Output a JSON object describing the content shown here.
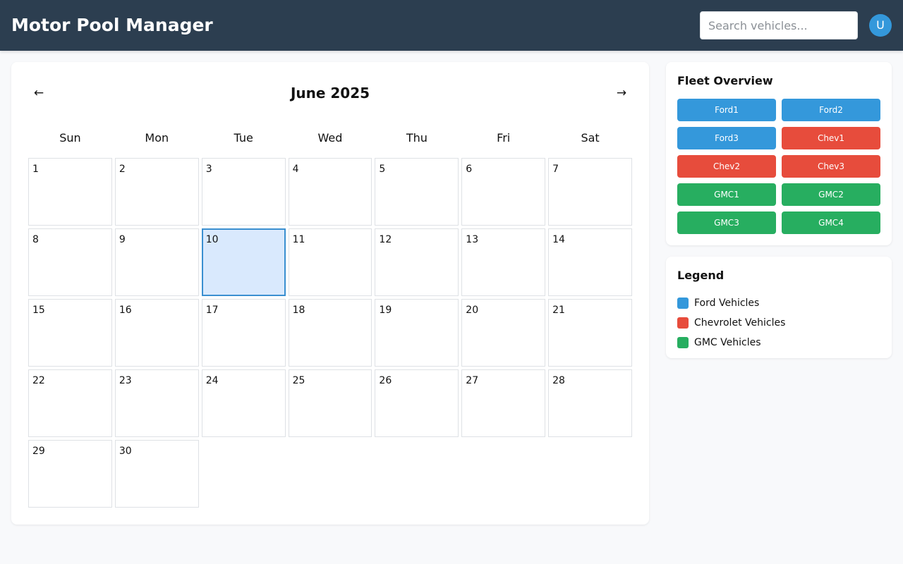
{
  "header": {
    "title": "Motor Pool Manager",
    "search_placeholder": "Search vehicles...",
    "avatar_initial": "U"
  },
  "calendar": {
    "month_label": "June 2025",
    "prev_label": "←",
    "next_label": "→",
    "weekdays": [
      "Sun",
      "Mon",
      "Tue",
      "Wed",
      "Thu",
      "Fri",
      "Sat"
    ],
    "start_weekday_index": 0,
    "days": [
      "1",
      "2",
      "3",
      "4",
      "5",
      "6",
      "7",
      "8",
      "9",
      "10",
      "11",
      "12",
      "13",
      "14",
      "15",
      "16",
      "17",
      "18",
      "19",
      "20",
      "21",
      "22",
      "23",
      "24",
      "25",
      "26",
      "27",
      "28",
      "29",
      "30"
    ],
    "selected_day": "10"
  },
  "fleet": {
    "title": "Fleet Overview",
    "vehicles": [
      {
        "label": "Ford1",
        "make": "ford"
      },
      {
        "label": "Ford2",
        "make": "ford"
      },
      {
        "label": "Ford3",
        "make": "ford"
      },
      {
        "label": "Chev1",
        "make": "chevrolet"
      },
      {
        "label": "Chev2",
        "make": "chevrolet"
      },
      {
        "label": "Chev3",
        "make": "chevrolet"
      },
      {
        "label": "GMC1",
        "make": "gmc"
      },
      {
        "label": "GMC2",
        "make": "gmc"
      },
      {
        "label": "GMC3",
        "make": "gmc"
      },
      {
        "label": "GMC4",
        "make": "gmc"
      }
    ]
  },
  "legend": {
    "title": "Legend",
    "items": [
      {
        "make": "ford",
        "label": "Ford Vehicles"
      },
      {
        "make": "chevrolet",
        "label": "Chevrolet Vehicles"
      },
      {
        "make": "gmc",
        "label": "GMC Vehicles"
      }
    ]
  },
  "colors": {
    "header_bg": "#2c3e50",
    "ford": "#3498db",
    "chevrolet": "#e74c3c",
    "gmc": "#27ae60",
    "selected_day_bg": "#d9e9fd",
    "selected_day_border": "#3a8fd0"
  }
}
